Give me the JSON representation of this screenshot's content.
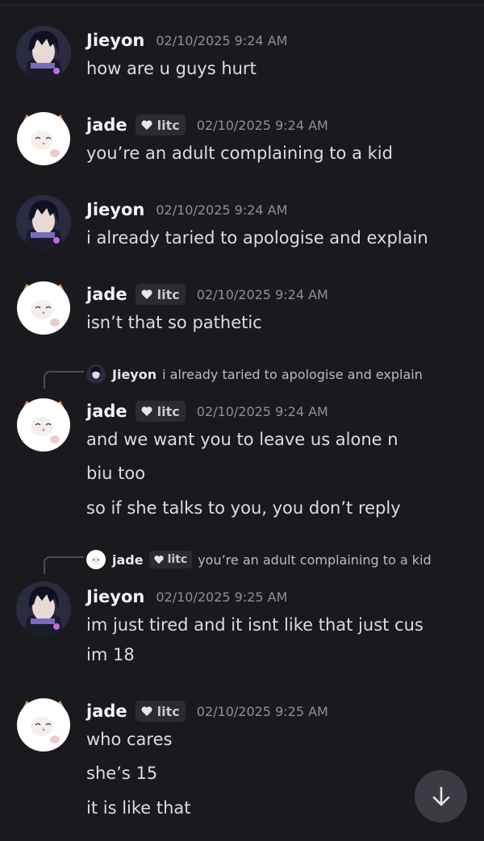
{
  "messages": [
    {
      "author": "Jieyon",
      "tag": "",
      "timestamp": "02/10/2025 9:24 AM",
      "lines": [
        "how are u guys hurt"
      ],
      "avatar_icon": "anime-character-avatar"
    },
    {
      "author": "jade",
      "tag": "litc",
      "timestamp": "02/10/2025 9:24 AM",
      "lines": [
        "you’re an adult complaining to a kid"
      ],
      "avatar_icon": "white-cat-avatar"
    },
    {
      "author": "Jieyon",
      "tag": "",
      "timestamp": "02/10/2025 9:24 AM",
      "lines": [
        "i already taried to apologise and explain"
      ],
      "avatar_icon": "anime-character-avatar"
    },
    {
      "author": "jade",
      "tag": "litc",
      "timestamp": "02/10/2025 9:24 AM",
      "lines": [
        "isn’t that so pathetic"
      ],
      "avatar_icon": "white-cat-avatar"
    },
    {
      "author": "jade",
      "tag": "litc",
      "timestamp": "02/10/2025 9:24 AM",
      "lines": [
        "and we want you to leave us alone n",
        "biu too",
        "so if she talks to you, you don’t reply"
      ],
      "avatar_icon": "white-cat-avatar",
      "reply_to": {
        "author": "Jieyon",
        "tag": "",
        "text": "i already taried to apologise and explain"
      }
    },
    {
      "author": "Jieyon",
      "tag": "",
      "timestamp": "02/10/2025 9:25 AM",
      "lines": [
        "im just tired and it isnt like that just cus",
        "im 18"
      ],
      "avatar_icon": "anime-character-avatar",
      "reply_to": {
        "author": "jade",
        "tag": "litc",
        "text": "you’re an adult complaining to a kid"
      }
    },
    {
      "author": "jade",
      "tag": "litc",
      "timestamp": "02/10/2025 9:25 AM",
      "lines": [
        "who cares",
        "she’s 15",
        "it is like that"
      ],
      "avatar_icon": "white-cat-avatar"
    }
  ],
  "scroll_button": {
    "icon": "arrow-down-icon"
  },
  "colors": {
    "background": "#1a1a1e",
    "username": "#f2f3f5",
    "timestamp": "#8e9097",
    "tag_bg": "#2b2c32",
    "scroll_bg": "#3a3b43"
  }
}
